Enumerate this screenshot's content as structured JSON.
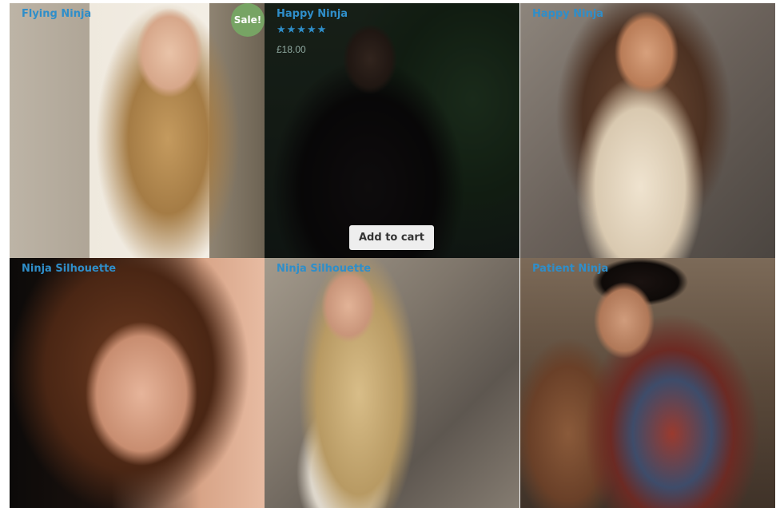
{
  "products": [
    {
      "title": "Flying Ninja",
      "badge": "Sale!",
      "image": "blonde-woman-on-stone-steps"
    },
    {
      "title": "Happy Ninja",
      "rating_stars": "★★★★★",
      "rating": 5,
      "price": "£18.00",
      "button": "Add to cart",
      "image": "woman-in-black-lace-dress"
    },
    {
      "title": "Happy Ninja",
      "image": "smiling-woman-in-plaid-scarf"
    },
    {
      "title": "Ninja Silhouette",
      "image": "brunette-woman-with-bangs"
    },
    {
      "title": "Ninja Silhouette",
      "image": "blonde-woman-by-stone-wall"
    },
    {
      "title": "Patient Ninja",
      "image": "woman-in-striped-knit-dress"
    }
  ]
}
